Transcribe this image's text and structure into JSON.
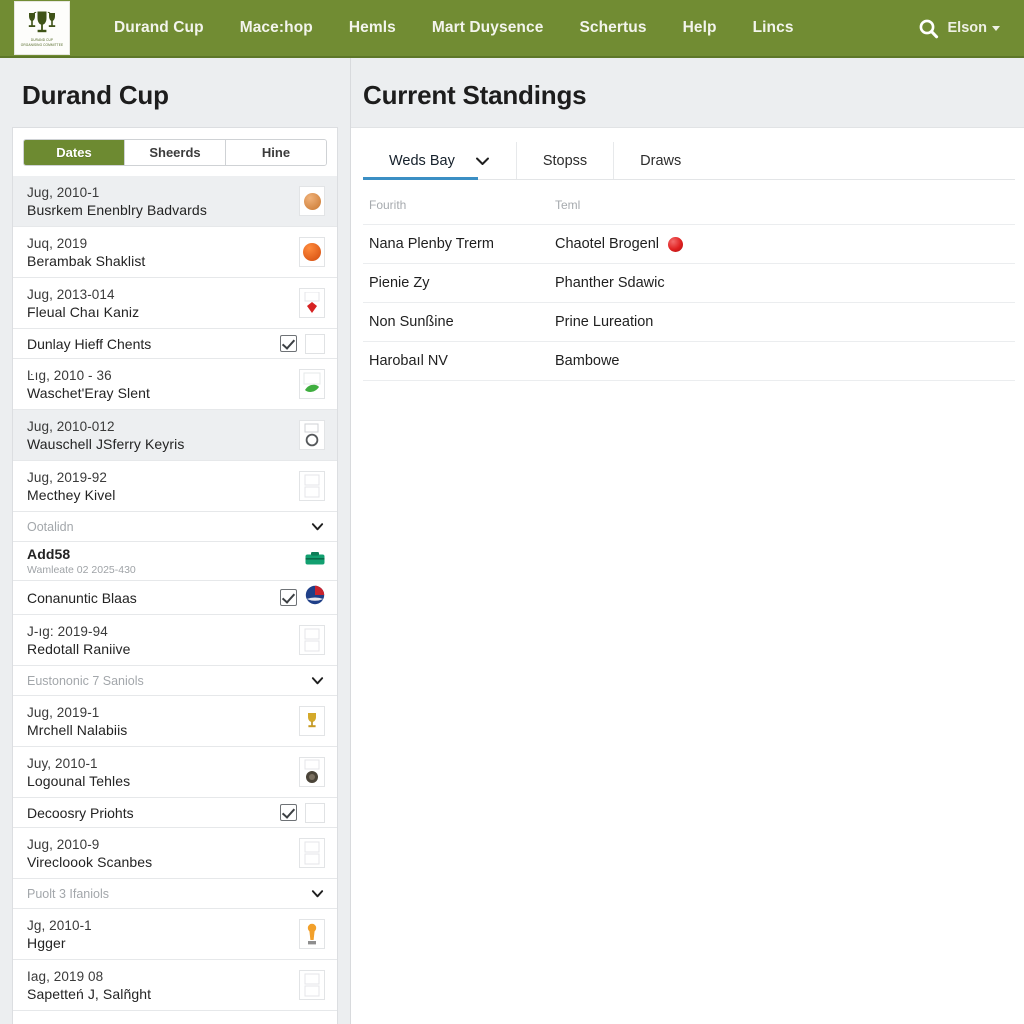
{
  "navbar": {
    "brand": {
      "icon": "trophy-crest-logo",
      "crest_line1": "DURAND CUP",
      "crest_line2": "ORGANISING COMMITTEE"
    },
    "links": [
      {
        "label": "Durand Cup"
      },
      {
        "label": "Mace:hop"
      },
      {
        "label": "Hemls"
      },
      {
        "label": "Mart Duysence"
      },
      {
        "label": "Schertus"
      },
      {
        "label": "Help"
      },
      {
        "label": "Lincs"
      }
    ],
    "search_icon": "search-icon",
    "user_label": "Elson",
    "accent_green": "#718c33"
  },
  "left": {
    "title": "Durand Cup",
    "segments": [
      {
        "label": "Dates",
        "active": true
      },
      {
        "label": "Sheerds",
        "active": false
      },
      {
        "label": "Hine",
        "active": false
      }
    ],
    "rows": [
      {
        "type": "event",
        "date": "Jug, 2010-1",
        "name": "Busrkem Enenblry Badvards",
        "alt": true,
        "thumb": "avatar-orange-round"
      },
      {
        "type": "event",
        "date": "Juq, 2019",
        "name": "Berambak Shaklist",
        "alt": false,
        "thumb": "avatar-orange-ball"
      },
      {
        "type": "event",
        "date": "Jug, 2013-014",
        "name": "Fleual Chaı Kaniz",
        "alt": false,
        "thumb": "avatar-red-emblem"
      },
      {
        "type": "single",
        "name": "Dunlay Hieff Chents",
        "alt": false,
        "check": true,
        "thumb": "thumb-blank-box"
      },
      {
        "type": "event",
        "date": "Ŀıg, 2010 - 36",
        "name": "Waschet'Eray Slent",
        "alt": false,
        "thumb": "avatar-green-leaf"
      },
      {
        "type": "event",
        "date": "Jug, 2010-012",
        "name": "Wauschell JSferry Keyris",
        "alt": true,
        "thumb": "avatar-grey-ring"
      },
      {
        "type": "event",
        "date": "Jug, 2019-92",
        "name": "Mecthey Kivel",
        "alt": false,
        "thumb": "thumb-blank-box"
      },
      {
        "type": "group",
        "name": "Ootalidn",
        "alt": false,
        "chevron": true
      },
      {
        "type": "addsub",
        "name": "Add58",
        "sub": "Wamleate 02 2025-430",
        "alt": false,
        "thumb": "badge-green-bag"
      },
      {
        "type": "single",
        "name": "Conanuntic Blaas",
        "alt": false,
        "check": true,
        "thumb": "avatar-flag-round"
      },
      {
        "type": "event",
        "date": "J-ıg: 2019-94",
        "name": "Redotall Raniive",
        "alt": false,
        "thumb": "thumb-blank-box"
      },
      {
        "type": "group",
        "name": "Eustononic 7 Saniols",
        "alt": false,
        "chevron": true
      },
      {
        "type": "event",
        "date": "Jug, 2019-1",
        "name": "Mrchell Nalabiis",
        "alt": false,
        "thumb": "avatar-gold-trophy"
      },
      {
        "type": "event",
        "date": "Juy, 2010-1",
        "name": "Logounal Tehles",
        "alt": false,
        "thumb": "avatar-dark-medal"
      },
      {
        "type": "single",
        "name": "Decoosry Priohts",
        "alt": false,
        "check": true,
        "thumb": "thumb-blank-box"
      },
      {
        "type": "event",
        "date": "Jug, 2010-9",
        "name": "Virecloook Scanbes",
        "alt": false,
        "thumb": "thumb-blank-box"
      },
      {
        "type": "group",
        "name": "Puolt 3 Ifaniols",
        "alt": false,
        "chevron": true
      },
      {
        "type": "event",
        "date": "Jg, 2010-1",
        "name": "Hgger",
        "alt": false,
        "thumb": "avatar-orange-marker"
      },
      {
        "type": "event",
        "date": "Iag, 2019 08",
        "name": "Sapetteń J, Salñght",
        "alt": false,
        "thumb": "thumb-blank-box"
      }
    ]
  },
  "right": {
    "title": "Current Standings",
    "tabs": [
      {
        "label": "Weds Bay",
        "active": true,
        "caret": true
      },
      {
        "label": "Stopss",
        "active": false,
        "caret": false
      },
      {
        "label": "Draws",
        "active": false,
        "caret": false
      }
    ],
    "table": {
      "headers": [
        "Fourith",
        "Teml"
      ],
      "rows": [
        {
          "c1": "Nana Plenby Trerm",
          "c2": "Chaotel Brogenl",
          "badge": "red-ball-icon"
        },
        {
          "c1": "Pienie Zy",
          "c2": "Phanther Sdawic",
          "badge": ""
        },
        {
          "c1": "Non Sunßine",
          "c2": "Prine Lureation",
          "badge": ""
        },
        {
          "c1": "Harobaıl NV",
          "c2": "Bambowe",
          "badge": ""
        }
      ]
    }
  }
}
